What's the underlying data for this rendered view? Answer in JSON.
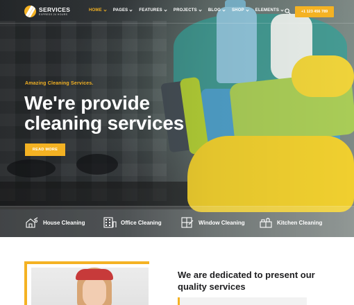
{
  "brand": {
    "name": "SERVICES",
    "tagline": "EXPRESS 24 HOURS",
    "accent_color": "#f4b223"
  },
  "nav": {
    "items": [
      {
        "label": "HOME",
        "active": true
      },
      {
        "label": "PAGES",
        "active": false
      },
      {
        "label": "FEATURES",
        "active": false
      },
      {
        "label": "PROJECTS",
        "active": false
      },
      {
        "label": "BLOG",
        "active": false
      },
      {
        "label": "SHOP",
        "active": false
      },
      {
        "label": "ELEMENTS",
        "active": false
      }
    ],
    "search_icon": "search-icon",
    "phone": "+1 123 456 789"
  },
  "hero": {
    "kicker": "Amazing Cleaning Services.",
    "headline_line1": "We're provide",
    "headline_line2": "cleaning services",
    "cta": "READ MORE"
  },
  "services": [
    {
      "label": "House Cleaning",
      "icon": "house-cleaning-icon"
    },
    {
      "label": "Office Cleaning",
      "icon": "office-building-icon"
    },
    {
      "label": "Window Cleaning",
      "icon": "window-icon"
    },
    {
      "label": "Kitchen Cleaning",
      "icon": "kitchen-icon"
    }
  ],
  "about": {
    "title": "We are dedicated to present our quality services"
  }
}
